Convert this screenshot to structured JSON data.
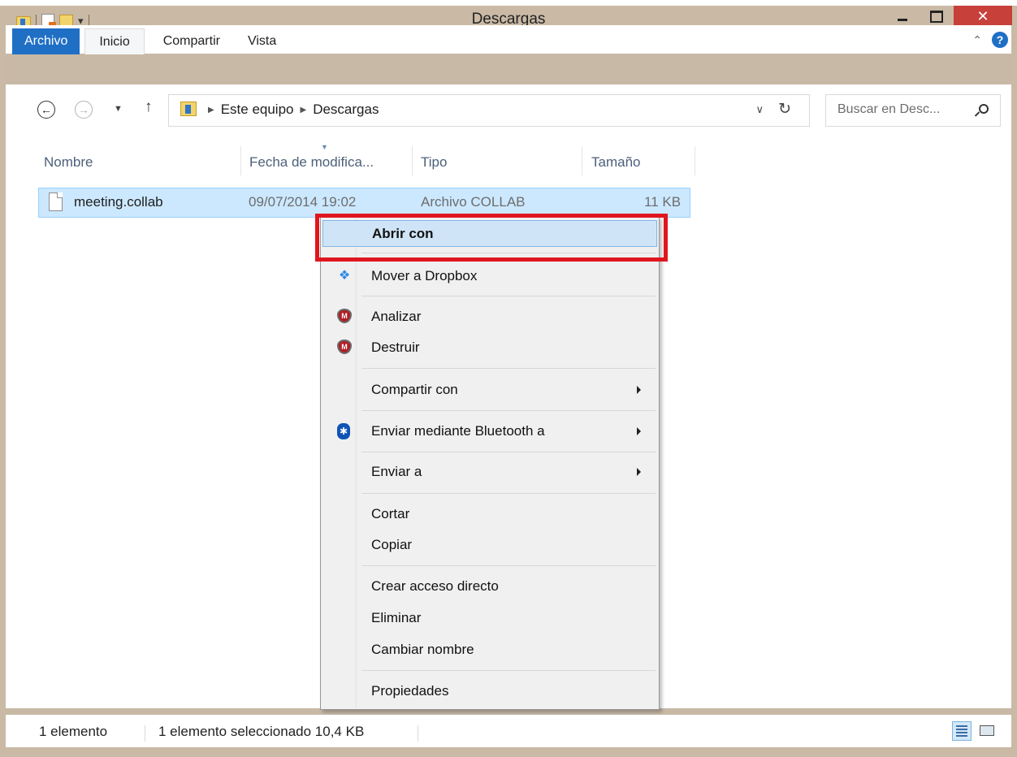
{
  "window": {
    "title": "Descargas"
  },
  "ribbon": {
    "tabs": [
      {
        "label": "Archivo"
      },
      {
        "label": "Inicio"
      },
      {
        "label": "Compartir"
      },
      {
        "label": "Vista"
      }
    ]
  },
  "address": {
    "crumbs": [
      "Este equipo",
      "Descargas"
    ],
    "search_placeholder": "Buscar en Desc..."
  },
  "columns": {
    "name": "Nombre",
    "date": "Fecha de modifica...",
    "type": "Tipo",
    "size": "Tamaño"
  },
  "files": [
    {
      "name": "meeting.collab",
      "date": "09/07/2014 19:02",
      "type": "Archivo COLLAB",
      "size": "11 KB",
      "selected": true
    }
  ],
  "context_menu": {
    "items": [
      {
        "label": "Abrir con",
        "bold": true,
        "highlighted": true
      },
      {
        "label": "Mover a Dropbox",
        "icon": "dropbox-icon"
      },
      {
        "label": "Analizar",
        "icon": "mcafee-icon"
      },
      {
        "label": "Destruir",
        "icon": "mcafee-icon"
      },
      {
        "label": "Compartir con",
        "submenu": true
      },
      {
        "label": "Enviar mediante Bluetooth a",
        "icon": "bluetooth-icon",
        "submenu": true
      },
      {
        "label": "Enviar a",
        "submenu": true
      },
      {
        "label": "Cortar"
      },
      {
        "label": "Copiar"
      },
      {
        "label": "Crear acceso directo"
      },
      {
        "label": "Eliminar"
      },
      {
        "label": "Cambiar nombre"
      },
      {
        "label": "Propiedades"
      }
    ]
  },
  "status": {
    "count": "1 elemento",
    "selection": "1 elemento seleccionado  10,4 KB"
  },
  "colors": {
    "accent": "#1f6fc5",
    "selection": "#cce8ff",
    "close_button": "#c7403a",
    "highlight_border": "#e0161e"
  }
}
